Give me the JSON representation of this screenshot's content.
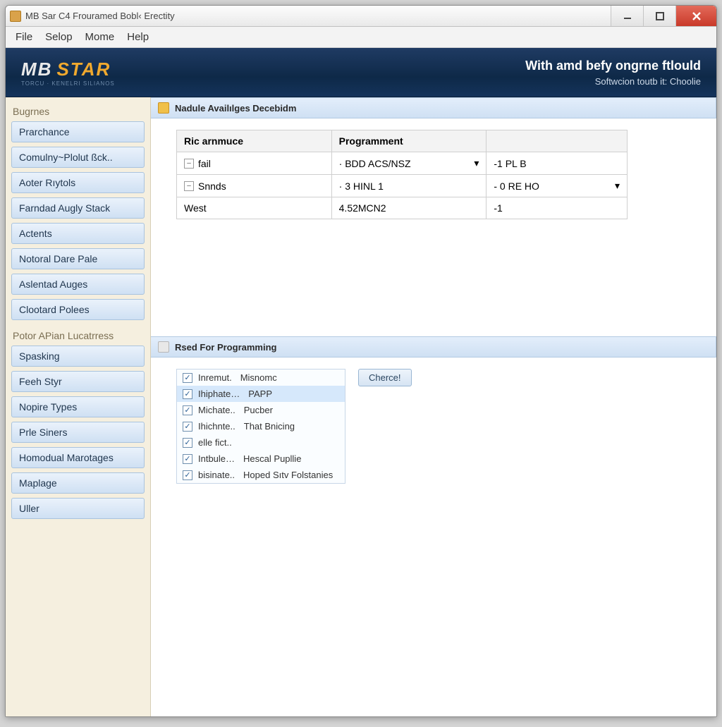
{
  "window": {
    "title": "MB Sar C4 Frouramed Bobl‹ Erectity"
  },
  "menubar": [
    "File",
    "Selop",
    "Mome",
    "Help"
  ],
  "banner": {
    "logo1": "MB",
    "logo2": "STAR",
    "logosub": "TORCU  ·  KENELRI SILIANOS",
    "line1": "With amd befy ongrne ftlould",
    "line2": "Softwcion toutb it: Choolie"
  },
  "sidebar": {
    "groups": [
      {
        "title": "Bugrnes",
        "items": [
          "Prarchance",
          "Comulny~Plolut ßck..",
          "Aoter Rıytols",
          "Farndad Augly Stack",
          "Actents",
          "Notoral Dare Pale",
          "Aslentad Auges",
          "Clootard Polees"
        ]
      },
      {
        "title": "Potor APian Lucatrress",
        "items": [
          "Spasking",
          "Feeh Styr",
          "Nopire Types",
          "Prle Siners",
          "Homodual Marotages",
          "Maplage",
          "Uller"
        ]
      }
    ]
  },
  "panel1": {
    "title": "Nadule Availılges Decebidm",
    "columns": [
      "Ric arnmuce",
      "Programment",
      ""
    ],
    "rows": [
      {
        "c0": "fail",
        "c1": "BDD ACS/NSZ",
        "c2": "-1 PL B",
        "box": true,
        "drop1": true,
        "drop2": false
      },
      {
        "c0": "Snnds",
        "c1": "3 HINL 1",
        "c2": "- 0 RE HO",
        "box": true,
        "drop1": false,
        "drop2": true
      },
      {
        "c0": "West",
        "c1": "4.52MCN2",
        "c2": "-1",
        "box": false,
        "drop1": false,
        "drop2": false
      }
    ]
  },
  "panel2": {
    "title": "Rsed For Programming",
    "button": "Cherce!",
    "items": [
      {
        "k": "Inremut.",
        "v": "Misnomc",
        "sel": false
      },
      {
        "k": "Ihiphate…",
        "v": "PAPP",
        "sel": true
      },
      {
        "k": "Michate..",
        "v": "Pucber",
        "sel": false
      },
      {
        "k": "Ihichnte..",
        "v": "That Bnicing",
        "sel": false
      },
      {
        "k": "elle fict..",
        "v": "",
        "sel": false
      },
      {
        "k": "Intbule…",
        "v": "Hescal Pupllie",
        "sel": false
      },
      {
        "k": "bisinate..",
        "v": "Hoped Sıtv Folstanies",
        "sel": false
      }
    ]
  }
}
